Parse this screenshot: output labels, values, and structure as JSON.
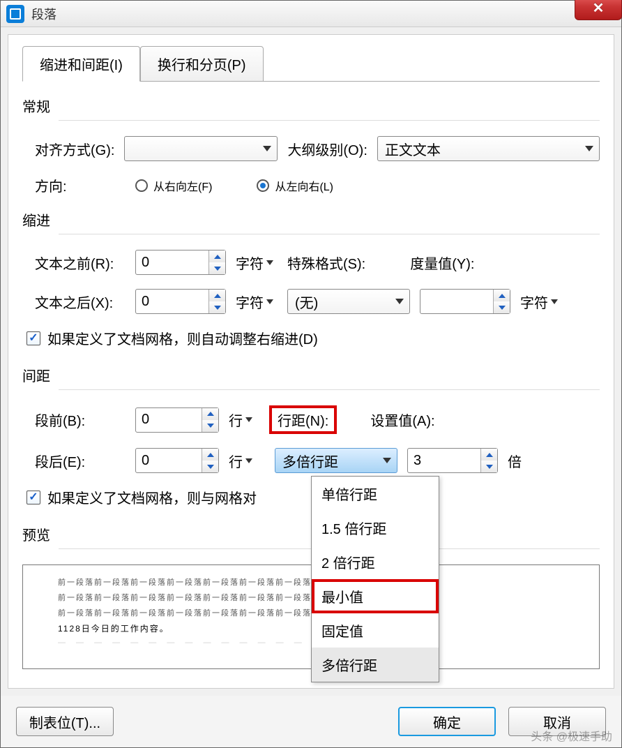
{
  "window": {
    "title": "段落"
  },
  "tabs": {
    "indent": "缩进和间距(I)",
    "flow": "换行和分页(P)"
  },
  "groups": {
    "general": "常规",
    "indent": "缩进",
    "spacing": "间距",
    "preview": "预览"
  },
  "general": {
    "alignment_label": "对齐方式(G):",
    "alignment_value": "",
    "outline_label": "大纲级别(O):",
    "outline_value": "正文文本",
    "direction_label": "方向:",
    "dir_rtl": "从右向左(F)",
    "dir_ltr": "从左向右(L)"
  },
  "indent": {
    "before_label": "文本之前(R):",
    "before_value": "0",
    "after_label": "文本之后(X):",
    "after_value": "0",
    "unit_char": "字符",
    "special_label": "特殊格式(S):",
    "special_value": "(无)",
    "measure_label": "度量值(Y):",
    "measure_value": "",
    "auto_adjust": "如果定义了文档网格，则自动调整右缩进(D)"
  },
  "spacing": {
    "before_label": "段前(B):",
    "before_value": "0",
    "after_label": "段后(E):",
    "after_value": "0",
    "unit_line": "行",
    "linespacing_label": "行距(N):",
    "linespacing_value": "多倍行距",
    "setvalue_label": "设置值(A):",
    "setvalue_value": "3",
    "unit_times": "倍",
    "snap_grid": "如果定义了文档网格，则与网格对"
  },
  "linespacing_options": {
    "single": "单倍行距",
    "one_half": "1.5 倍行距",
    "double": "2 倍行距",
    "min": "最小值",
    "fixed": "固定值",
    "multiple": "多倍行距"
  },
  "preview": {
    "placeholder_line": "前一段落前一段落前一段落前一段落前一段落前一段落前一段落前一段落前一段落",
    "sample_line": "1128日今日的工作内容。"
  },
  "buttons": {
    "tabs": "制表位(T)...",
    "ok": "确定",
    "cancel": "取消"
  },
  "watermark": "头条 @极速手助"
}
